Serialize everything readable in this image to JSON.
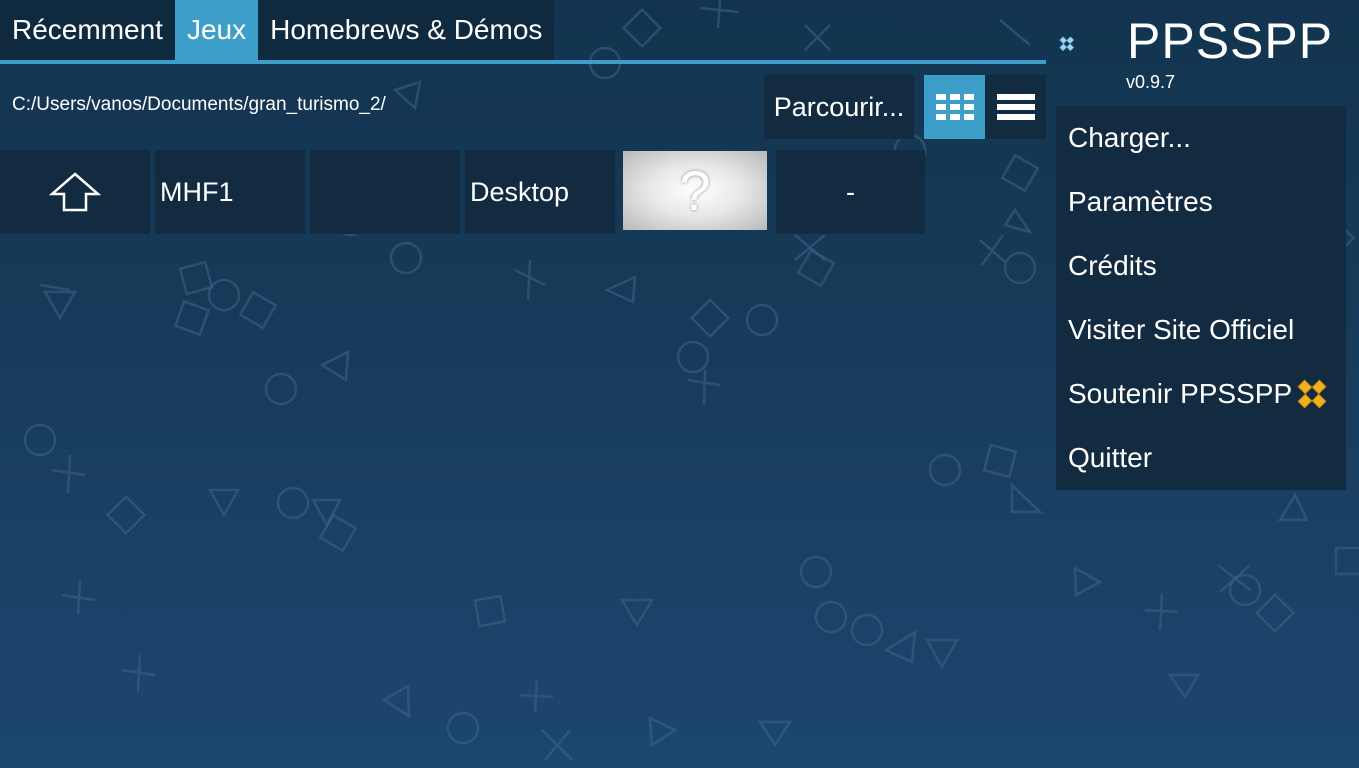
{
  "tabs": [
    {
      "label": "Récemment",
      "active": false
    },
    {
      "label": "Jeux",
      "active": true
    },
    {
      "label": "Homebrews & Démos",
      "active": false
    }
  ],
  "browser": {
    "path": "C:/Users/vanos/Documents/gran_turismo_2/",
    "browse_label": "Parcourir...",
    "view_grid_icon": "grid-icon",
    "view_list_icon": "list-icon",
    "grid_view_active": true
  },
  "tiles": {
    "up_icon": "arrow-up-icon",
    "items": [
      "MHF1",
      "",
      "Desktop",
      "?",
      "-"
    ]
  },
  "app": {
    "name": "PPSSPP",
    "version": "v0.9.7"
  },
  "menu": {
    "items": [
      "Charger...",
      "Paramètres",
      "Crédits",
      "Visiter Site Officiel",
      "Soutenir PPSSPP",
      "Quitter"
    ]
  },
  "colors": {
    "accent": "#3d9fc9",
    "panel": "#122b40",
    "background_top": "#12344f",
    "background_bottom": "#1d4670",
    "logo_blue": "#9fd3ee",
    "gold": "#f2b21f"
  }
}
